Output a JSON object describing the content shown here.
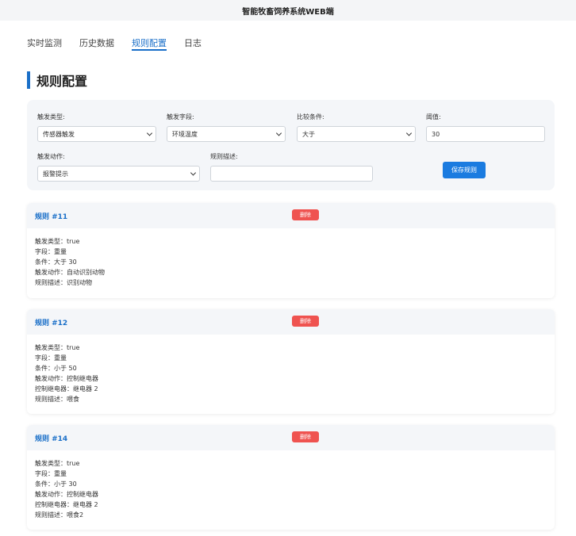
{
  "app_title": "智能牧畜饲养系统WEB端",
  "tabs": [
    {
      "label": "实时监测"
    },
    {
      "label": "历史数据"
    },
    {
      "label": "规则配置"
    },
    {
      "label": "日志"
    }
  ],
  "page_title": "规则配置",
  "form": {
    "trigger_type": {
      "label": "触发类型:",
      "value": "传感器触发"
    },
    "trigger_field": {
      "label": "触发字段:",
      "value": "环境温度"
    },
    "compare": {
      "label": "比较条件:",
      "value": "大于"
    },
    "threshold": {
      "label": "阈值:",
      "value": "30"
    },
    "action": {
      "label": "触发动作:",
      "value": "报警提示"
    },
    "description": {
      "label": "规则描述:",
      "value": ""
    },
    "save_label": "保存规则"
  },
  "delete_label": "删除",
  "rules": [
    {
      "title": "规则 #11",
      "lines": [
        "触发类型：true",
        "字段：重量",
        "条件：大于 30",
        "触发动作：自动识别动物",
        "规则描述：识别动物"
      ]
    },
    {
      "title": "规则 #12",
      "lines": [
        "触发类型：true",
        "字段：重量",
        "条件：小于 50",
        "触发动作：控制继电器",
        "控制继电器：继电器 2",
        "规则描述：喂食"
      ]
    },
    {
      "title": "规则 #14",
      "lines": [
        "触发类型：true",
        "字段：重量",
        "条件：小于 30",
        "触发动作：控制继电器",
        "控制继电器：继电器 2",
        "规则描述：喂食2"
      ]
    }
  ],
  "colors": {
    "accent": "#1a6fc8",
    "danger": "#ef5350",
    "button": "#1a7be0"
  }
}
